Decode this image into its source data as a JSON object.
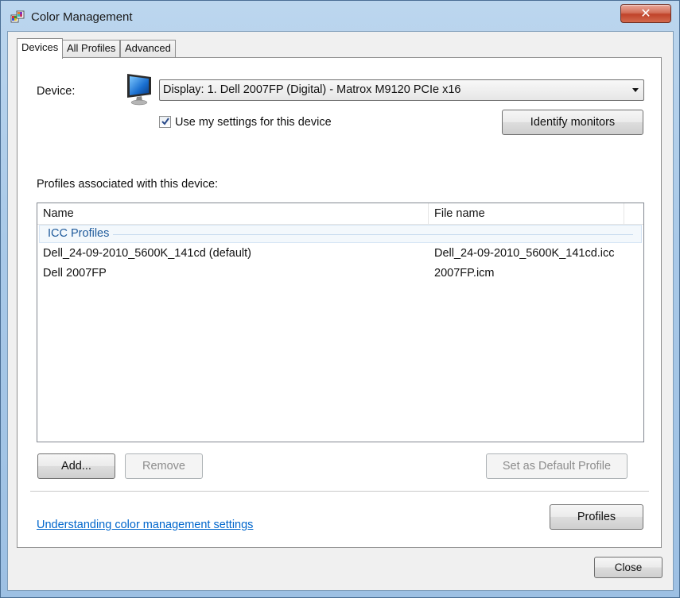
{
  "window": {
    "title": "Color Management",
    "close_glyph": "✕"
  },
  "tabs": [
    {
      "label": "Devices",
      "active": true
    },
    {
      "label": "All Profiles",
      "active": false
    },
    {
      "label": "Advanced",
      "active": false
    }
  ],
  "device": {
    "label": "Device:",
    "selected": "Display: 1. Dell 2007FP (Digital) - Matrox M9120 PCIe x16",
    "use_settings_label": "Use my settings for this device",
    "use_settings_checked": true,
    "identify_button": "Identify monitors"
  },
  "profiles": {
    "label": "Profiles associated with this device:",
    "columns": [
      "Name",
      "File name"
    ],
    "group": "ICC Profiles",
    "rows": [
      {
        "name": "Dell_24-09-2010_5600K_141cd (default)",
        "file": "Dell_24-09-2010_5600K_141cd.icc"
      },
      {
        "name": "Dell 2007FP",
        "file": "2007FP.icm"
      }
    ]
  },
  "buttons": {
    "add": "Add...",
    "remove": "Remove",
    "set_default": "Set as Default Profile",
    "profiles": "Profiles",
    "close": "Close"
  },
  "link": "Understanding color management settings",
  "colors": {
    "link": "#0066cc",
    "group_label": "#1e5a9b",
    "close_button": "#c0432a"
  }
}
